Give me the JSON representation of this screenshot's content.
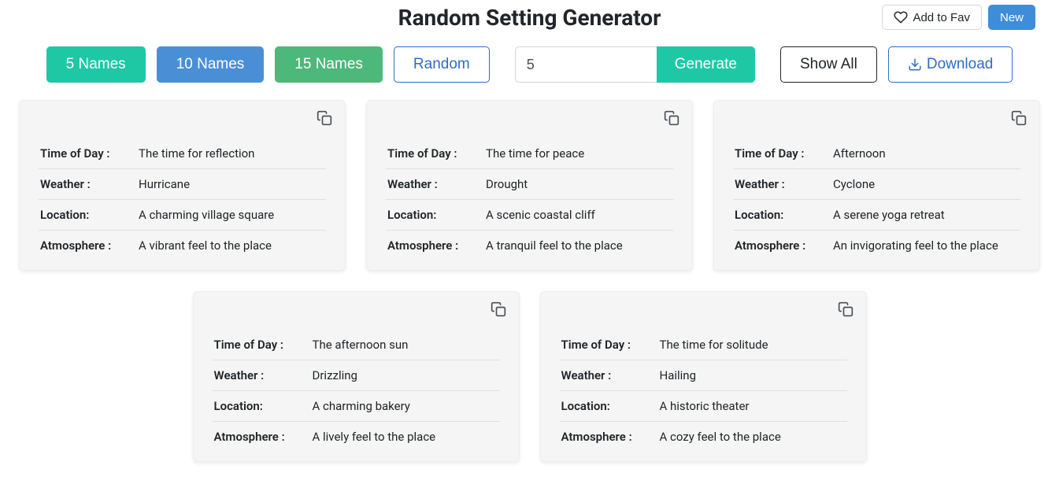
{
  "header": {
    "title": "Random Setting Generator",
    "fav_label": "Add to Fav",
    "new_label": "New"
  },
  "controls": {
    "btn_5": "5 Names",
    "btn_10": "10 Names",
    "btn_15": "15 Names",
    "random": "Random",
    "qty": "5",
    "generate": "Generate",
    "show_all": "Show All",
    "download": "Download"
  },
  "labels": {
    "time_of_day": "Time of Day :",
    "weather": "Weather :",
    "location": "Location:",
    "atmosphere": "Atmosphere :"
  },
  "cards": [
    {
      "time_of_day": "The time for reflection",
      "weather": "Hurricane",
      "location": "A charming village square",
      "atmosphere": "A vibrant feel to the place"
    },
    {
      "time_of_day": "The time for peace",
      "weather": "Drought",
      "location": "A scenic coastal cliff",
      "atmosphere": "A tranquil feel to the place"
    },
    {
      "time_of_day": "Afternoon",
      "weather": "Cyclone",
      "location": "A serene yoga retreat",
      "atmosphere": "An invigorating feel to the place"
    },
    {
      "time_of_day": "The afternoon sun",
      "weather": "Drizzling",
      "location": "A charming bakery",
      "atmosphere": "A lively feel to the place"
    },
    {
      "time_of_day": "The time for solitude",
      "weather": "Hailing",
      "location": "A historic theater",
      "atmosphere": "A cozy feel to the place"
    }
  ]
}
